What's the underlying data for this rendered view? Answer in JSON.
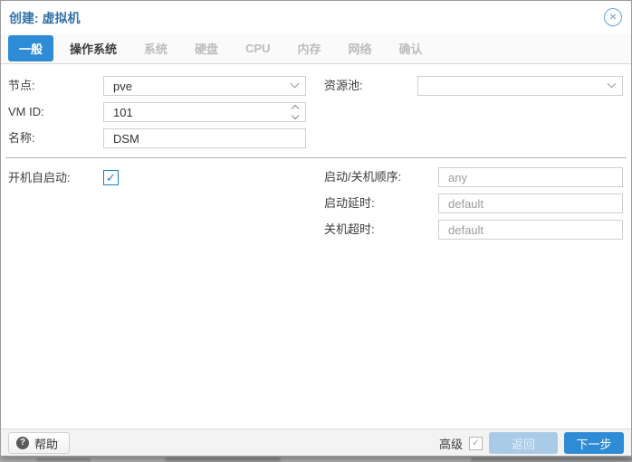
{
  "window": {
    "title": "创建: 虚拟机"
  },
  "tabs": [
    {
      "label": "一般",
      "state": "active"
    },
    {
      "label": "操作系统",
      "state": "enabled"
    },
    {
      "label": "系统",
      "state": "disabled"
    },
    {
      "label": "硬盘",
      "state": "disabled"
    },
    {
      "label": "CPU",
      "state": "disabled"
    },
    {
      "label": "内存",
      "state": "disabled"
    },
    {
      "label": "网络",
      "state": "disabled"
    },
    {
      "label": "确认",
      "state": "disabled"
    }
  ],
  "form": {
    "node": {
      "label": "节点:",
      "value": "pve"
    },
    "resource_pool": {
      "label": "资源池:",
      "value": ""
    },
    "vm_id": {
      "label": "VM ID:",
      "value": "101"
    },
    "name": {
      "label": "名称:",
      "value": "DSM"
    },
    "start_at_boot": {
      "label": "开机自启动:",
      "checked": true
    },
    "startup_order": {
      "label": "启动/关机顺序:",
      "placeholder": "any"
    },
    "startup_delay": {
      "label": "启动延时:",
      "placeholder": "default"
    },
    "shutdown_timeout": {
      "label": "关机超时:",
      "placeholder": "default"
    }
  },
  "footer": {
    "help_label": "帮助",
    "advanced_label": "高级",
    "advanced_checked": true,
    "back_label": "返回",
    "next_label": "下一步"
  },
  "icons": {
    "close": "×",
    "help": "?",
    "check": "✓"
  },
  "colors": {
    "accent_blue": "#2e8bd6",
    "title_blue": "#3273a8",
    "disabled_tab_text": "#bcbcbc",
    "disabled_button_bg": "#a9cbe8",
    "checkbox_blue": "#1d7ec7",
    "footer_bg": "#f3f3f3"
  }
}
